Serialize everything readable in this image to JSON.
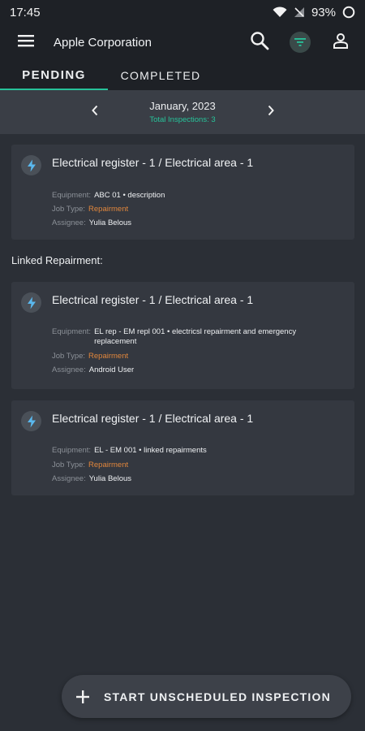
{
  "status_bar": {
    "time": "17:45",
    "battery": "93%"
  },
  "app_bar": {
    "title": "Apple Corporation"
  },
  "tabs": [
    {
      "label": "PENDING",
      "active": true
    },
    {
      "label": "COMPLETED",
      "active": false
    }
  ],
  "month_nav": {
    "month": "January, 2023",
    "total": "Total Inspections: 3"
  },
  "labels": {
    "equipment": "Equipment:",
    "job_type": "Job Type:",
    "assignee": "Assignee:"
  },
  "main_card": {
    "title": "Electrical register - 1 / Electrical area - 1",
    "equipment": "ABC 01 • description",
    "job_type": "Repairment",
    "assignee": "Yulia Belous"
  },
  "linked_section": {
    "label": "Linked Repairment:"
  },
  "linked_cards": [
    {
      "title": "Electrical register - 1 / Electrical area - 1",
      "equipment_line1": "EL rep - EM repl 001 • electricsl repairment and emergency",
      "equipment_line2": "replacement",
      "job_type": "Repairment",
      "assignee": "Android User"
    },
    {
      "title": "Electrical register - 1 / Electrical area - 1",
      "equipment": "EL - EM 001 • linked repairments",
      "job_type": "Repairment",
      "assignee": "Yulia Belous"
    }
  ],
  "fab": {
    "label": "START UNSCHEDULED INSPECTION"
  },
  "colors": {
    "accent": "#27c39a",
    "job_type": "#e0863c",
    "background": "#2b2f36",
    "card": "#343840"
  },
  "icons": [
    "wifi-icon",
    "signal-icon",
    "battery-icon",
    "menu-icon",
    "search-icon",
    "filter-icon",
    "profile-icon",
    "chevron-left-icon",
    "chevron-right-icon",
    "lightning-icon",
    "plus-icon"
  ]
}
